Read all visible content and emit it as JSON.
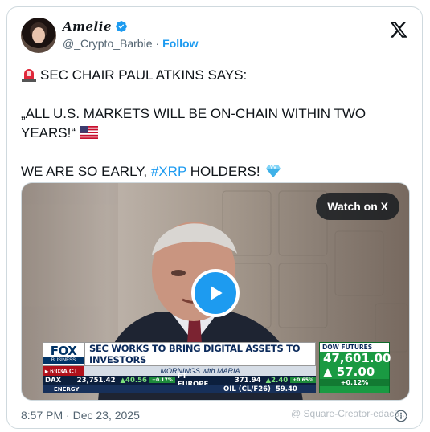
{
  "author": {
    "display_name": "Amelie",
    "handle": "@_Crypto_Barbie",
    "follow_label": "Follow",
    "verified_icon": "verified-badge-icon"
  },
  "tweet": {
    "line1": "SEC CHAIR PAUL ATKINS SAYS:",
    "line2": "„ALL U.S. MARKETS WILL BE ON-CHAIN WITHIN TWO YEARS!“",
    "line3_before": "WE ARE SO EARLY, ",
    "hashtag": "#XRP",
    "line3_after": " HOLDERS!"
  },
  "video": {
    "watch_label": "Watch on X",
    "ticker": {
      "network_top": "FOX",
      "network_bottom": "BUSINESS",
      "headline": "SEC WORKS TO BRING DIGITAL ASSETS TO INVESTORS",
      "time": "6:03A CT",
      "show": "MORNINGS with MARIA",
      "row1": {
        "name": "DAX",
        "value": "23,751.42",
        "change": "▲40.56",
        "pct": "+0.17%",
        "name2": "FT EUROPE",
        "value2": "371.94",
        "change2": "▲2.40",
        "pct2": "+0.65%"
      },
      "row2": {
        "name": "ENERGY",
        "name2": "OIL (CL/F26)",
        "value2": "59.40"
      },
      "futures": {
        "label": "DOW FUTURES",
        "value": "47,601.00",
        "change": "▲ 57.00",
        "pct": "+0.12%"
      }
    }
  },
  "footer": {
    "timestamp": "8:57 PM · Dec 23, 2025",
    "watermark": "@ Square-Creator-edac5..."
  },
  "colors": {
    "accent": "#1d9bf0",
    "text": "#0f1419",
    "muted": "#536471"
  }
}
